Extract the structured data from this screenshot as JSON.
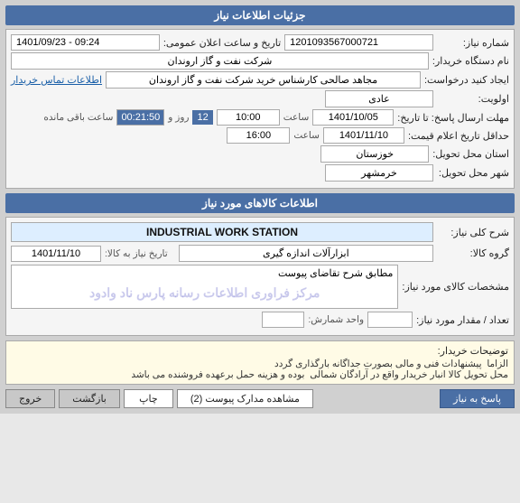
{
  "page": {
    "section1_header": "جزئیات اطلاعات نیاز",
    "section2_header": "اطلاعات کالاهای مورد نیاز",
    "labels": {
      "order_number": "شماره نیاز:",
      "buyer_name": "نام دستگاه خریدار:",
      "request_create": "ایجاد کنید درخواست:",
      "priority": "اولویت:",
      "send_date_from": "مهلت ارسال پاسخ: تا تاریخ:",
      "last_price_date": "حداقل تاریخ اعلام قیمت:",
      "delivery_province": "استان محل تحویل:",
      "delivery_city": "شهر محل تحویل:",
      "buyer_contact": "اطلاعات تماس خریدار",
      "goods_name": "شرح کلی نیاز:",
      "goods_group": "گروه کالا:",
      "goods_specs": "مشخصات کالای مورد نیاز:",
      "qty": "تعداد / مقدار مورد نیاز:",
      "buyer_description": "توضیحات خریدار:"
    },
    "values": {
      "order_number": "1201093567000721",
      "datetime_label": "تاریخ و ساعت اعلان عمومی:",
      "datetime_value": "1401/09/23 - 09:24",
      "buyer_name": "شرکت نفت و گاز اروندان",
      "request_creator": "مجاهد صالحی کارشناس خرید شرکت نفت و گاز اروندان",
      "priority": "عادی",
      "send_time_label": "ساعت",
      "send_time_value": "10:00",
      "send_date_value": "1401/10/05",
      "last_price_time_label": "ساعت",
      "last_price_time_value": "16:00",
      "last_price_date_value": "1401/11/10",
      "days_remaining_label": "روز و",
      "days_remaining_value": "12",
      "time_remaining_value": "00:21:50",
      "time_remaining_suffix": "ساعت باقی مانده",
      "delivery_province": "خوزستان",
      "delivery_city": "خرمشهر",
      "goods_name": "INDUSTRIAL WORK STATION",
      "goods_group_code": "",
      "goods_group_label": "ابزارآلات اندازه گیری",
      "goods_group_date_label": "تاریخ نیاز به کالا:",
      "goods_group_date_value": "1401/11/10",
      "specs_label": "مطابق شرح تقاضای پیوست",
      "qty_value": "",
      "qty_unit": "واحد شمارش:",
      "description": "الزاما  پیشنهادات فنی و مالی بصورت جداگانه بارگذاری گردد\nمحل تحویل کالا انبار خریدار واقع در آرادگان شمالی  بوده و هزینه حمل برعهده فروشنده می باشد"
    },
    "buttons": {
      "respond": "پاسخ به نیاز",
      "view_docs": "مشاهده مدارک پیوست (2)",
      "print": "چاپ",
      "return": "بازگشت",
      "exit": "خروج"
    }
  }
}
